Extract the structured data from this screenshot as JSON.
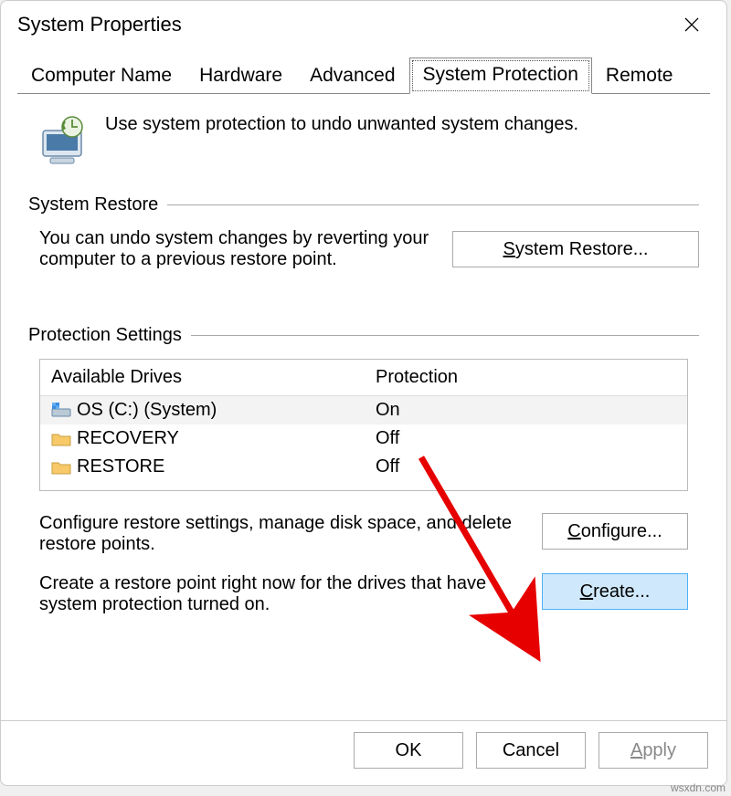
{
  "window": {
    "title": "System Properties"
  },
  "tabs": {
    "computer_name": "Computer Name",
    "hardware": "Hardware",
    "advanced": "Advanced",
    "system_protection": "System Protection",
    "remote": "Remote"
  },
  "intro": {
    "text": "Use system protection to undo unwanted system changes."
  },
  "restore": {
    "heading": "System Restore",
    "desc": "You can undo system changes by reverting your computer to a previous restore point.",
    "button_prefix": "S",
    "button_suffix": "ystem Restore..."
  },
  "protection": {
    "heading": "Protection Settings",
    "col_drives": "Available Drives",
    "col_protection": "Protection",
    "drives": [
      {
        "name": "OS (C:) (System)",
        "protection": "On",
        "type": "system"
      },
      {
        "name": "RECOVERY",
        "protection": "Off",
        "type": "folder"
      },
      {
        "name": "RESTORE",
        "protection": "Off",
        "type": "folder"
      }
    ],
    "configure_desc": "Configure restore settings, manage disk space, and delete restore points.",
    "configure_prefix": "C",
    "configure_suffix": "onfigure...",
    "create_desc": "Create a restore point right now for the drives that have system protection turned on.",
    "create_prefix": "C",
    "create_suffix": "reate..."
  },
  "footer": {
    "ok": "OK",
    "cancel": "Cancel",
    "apply_prefix": "A",
    "apply_suffix": "pply"
  },
  "watermark": "wsxdn.com"
}
